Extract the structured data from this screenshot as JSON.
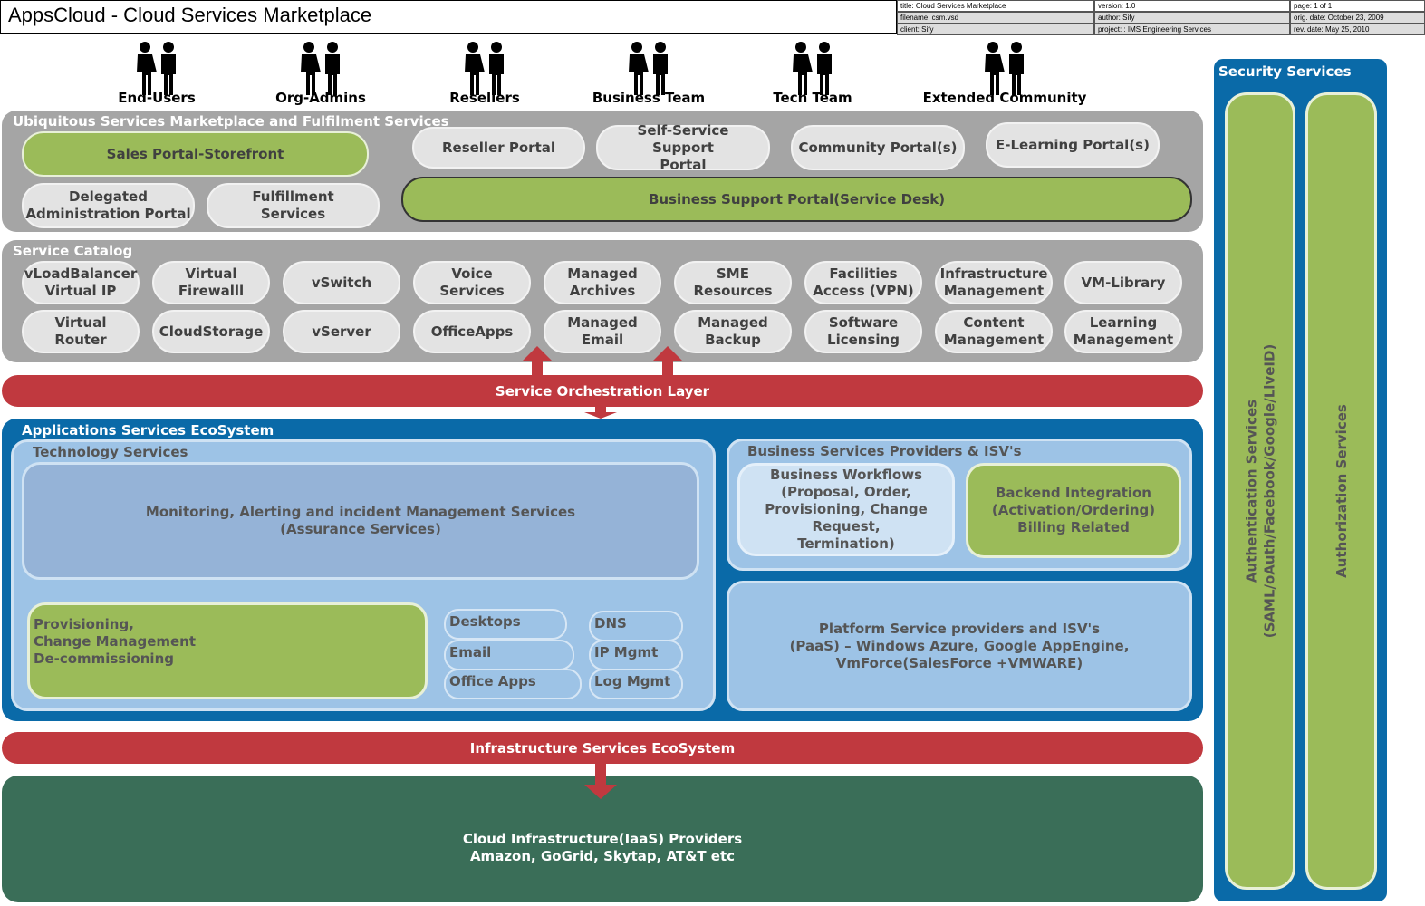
{
  "title": "AppsCloud - Cloud Services Marketplace",
  "meta": [
    "title: Cloud Services Marketplace",
    "version: 1.0",
    "page: 1 of 1",
    "filename: csm.vsd",
    "author: Sify",
    "orig. date: October 23, 2009",
    "client: Sify",
    "project: : IMS Engineering Services",
    "rev. date: May 25, 2010"
  ],
  "users": [
    "End-Users",
    "Org-Admins",
    "Resellers",
    "Business Team",
    "Tech Team",
    "Extended Community"
  ],
  "marketplace": {
    "title": "Ubiquitous Services Marketplace and Fulfilment Services",
    "sales": "Sales Portal-Storefront",
    "reseller": "Reseller Portal",
    "selfservice": "Self-Service Support Portal",
    "community": "Community Portal(s)",
    "elearning": "E-Learning Portal(s)",
    "delegated": "Delegated Administration Portal",
    "fulfillment": "Fulfillment Services",
    "business_support": "Business Support Portal(Service Desk)"
  },
  "catalog": {
    "title": "Service Catalog",
    "row1": [
      "vLoadBalancer Virtual IP",
      "Virtual Firewalll",
      "vSwitch",
      "Voice Services",
      "Managed Archives",
      "SME Resources",
      "Facilities Access (VPN)",
      "Infrastructure Management",
      "VM-Library"
    ],
    "row2": [
      "Virtual Router",
      "CloudStorage",
      "vServer",
      "OfficeApps",
      "Managed Email",
      "Managed Backup",
      "Software Licensing",
      "Content Management",
      "Learning Management"
    ]
  },
  "orchestration": "Service Orchestration Layer",
  "apps": {
    "title": "Applications Services EcoSystem",
    "tech_title": "Technology Services",
    "monitoring": "Monitoring, Alerting and incident Management Services\n(Assurance Services)",
    "provisioning": "Provisioning,\nChange Management\nDe-commissioning",
    "small": [
      "Desktops",
      "Email",
      "Office Apps",
      "DNS",
      "IP Mgmt",
      "Log Mgmt"
    ],
    "biz_title": "Business Services Providers & ISV's",
    "workflows": "Business Workflows (Proposal, Order, Provisioning, Change Request, Termination)",
    "backend": "Backend Integration (Activation/Ordering) Billing Related",
    "platform": "Platform Service providers and ISV's\n(PaaS) – Windows Azure, Google AppEngine,\nVmForce(SalesForce +VMWARE)"
  },
  "infra": "Infrastructure Services EcoSystem",
  "cloud": "Cloud Infrastructure(IaaS) Providers\nAmazon, GoGrid, Skytap, AT&T etc",
  "security": {
    "title": "Security Services",
    "auth": "Authentication Services\n(SAML/oAuth/Facebook/Google/LiveID)",
    "authz": "Authorization Services"
  },
  "colors": {
    "gray_panel": "#a5a5a5",
    "green": "#9bbb59",
    "red": "#c0393f",
    "blue": "#0a6aa8",
    "light_blue": "#9dc3e6",
    "dark_green": "#3a6e58"
  }
}
